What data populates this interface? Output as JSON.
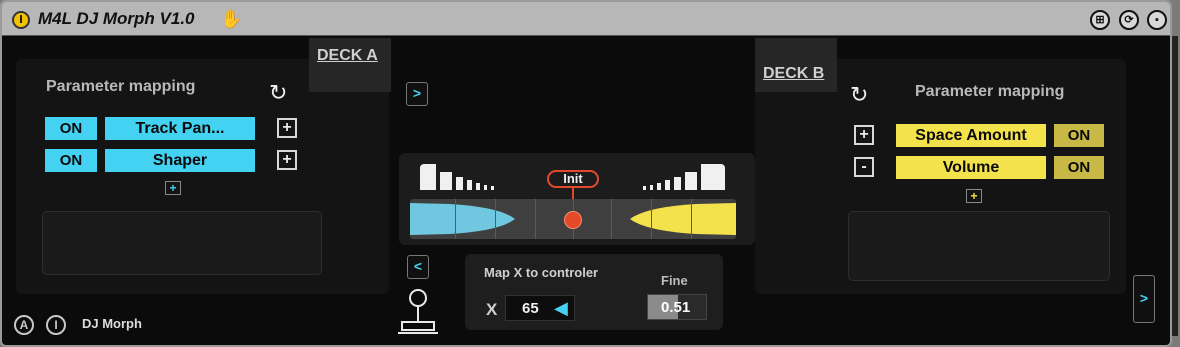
{
  "window": {
    "title": "M4L DJ Morph V1.0",
    "hand_icon": "hand-icon"
  },
  "titlebar_buttons": [
    {
      "name": "deck-toggle-button",
      "symbol": "⊞"
    },
    {
      "name": "refresh-button",
      "symbol": "⟳"
    },
    {
      "name": "save-button",
      "symbol": "▪"
    }
  ],
  "deck_a": {
    "tab_label": "DECK A",
    "title": "Parameter mapping",
    "rows": [
      {
        "toggle": "ON",
        "param": "Track Pan...",
        "action": "+"
      },
      {
        "toggle": "ON",
        "param": "Shaper",
        "action": "+"
      }
    ],
    "add_label": "+"
  },
  "deck_b": {
    "tab_label": "DECK B",
    "title": "Parameter mapping",
    "rows": [
      {
        "action": "+",
        "param": "Space Amount",
        "toggle": "ON"
      },
      {
        "action": "-",
        "param": "Volume",
        "toggle": "ON"
      }
    ],
    "add_label": "+"
  },
  "nav": {
    "right_top": ">",
    "left_mid": "<",
    "right_bottom": ">"
  },
  "morph": {
    "init_label": "Init",
    "position": 0.5,
    "colors": {
      "deck_a": "#44d2f2",
      "deck_b": "#f4e24c",
      "init": "#e24a2a"
    }
  },
  "controller": {
    "title": "Map X to controler",
    "fine_label": "Fine",
    "axis_label": "X",
    "axis_value": "65",
    "fine_value": "0.51",
    "fine_fraction": 0.51
  },
  "footer": {
    "btn_a": "A",
    "btn_i": "I",
    "label": "DJ Morph"
  }
}
